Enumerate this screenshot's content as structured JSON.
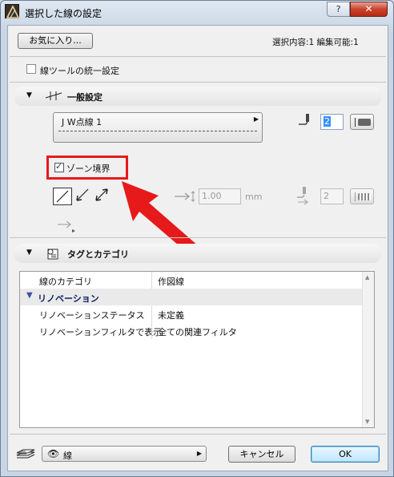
{
  "window": {
    "title": "選択した線の設定",
    "help_label": "?",
    "close_label": "✕"
  },
  "top": {
    "favorites_label": "お気に入り...",
    "selection_info": "選択内容:1 編集可能:1"
  },
  "unify": {
    "label": "線ツールの統一設定",
    "checked": false
  },
  "general": {
    "title": "一般設定",
    "line_type": "J W点線 1",
    "pen_value": "2",
    "zone_boundary_label": "ゾーン境界",
    "zone_boundary_checked": true,
    "arrow_size_value": "1.00",
    "arrow_size_unit": "mm",
    "arrow_pen_value": "2"
  },
  "tags": {
    "title": "タグとカテゴリ",
    "rows": [
      {
        "name": "線のカテゴリ",
        "value": "作図線"
      },
      {
        "group": "リノベーション"
      },
      {
        "name": "リノベーションステータス",
        "value": "未定義"
      },
      {
        "name": "リノベーションフィルタで表示",
        "value": "全ての関連フィルタ"
      }
    ]
  },
  "footer": {
    "layer_name": "線",
    "cancel_label": "キャンセル",
    "ok_label": "OK"
  },
  "colors": {
    "highlight": "#e61a1a",
    "close_button": "#c9432c",
    "selection": "#3390ff"
  }
}
